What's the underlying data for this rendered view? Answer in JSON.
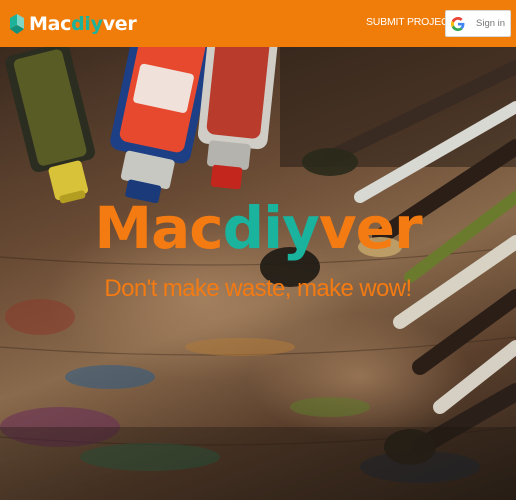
{
  "header": {
    "logo": {
      "text_main": "Mac",
      "text_highlight": "diy",
      "text_end": "ver",
      "icon": "box-logo-icon"
    },
    "submit_label": "SUBMIT PROJECT",
    "signin": {
      "label": "Sign in",
      "icon": "google-icon"
    }
  },
  "hero": {
    "title_main": "Mac",
    "title_highlight": "diy",
    "title_end": "ver",
    "tagline": "Don't make waste, make wow!"
  },
  "colors": {
    "brand_orange": "#f07d0a",
    "brand_teal": "#1db39b",
    "title_orange": "#f47a12",
    "white": "#ffffff"
  }
}
